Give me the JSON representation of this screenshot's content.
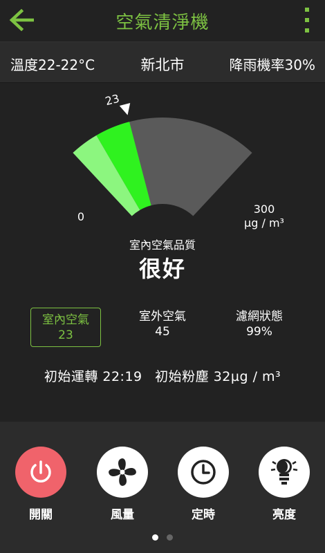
{
  "header": {
    "title": "空氣清淨機",
    "back_icon": "arrow-left-icon",
    "menu_icon": "more-vertical-icon",
    "accent_color": "#7dc242"
  },
  "weather": {
    "temperature": "溫度22-22°C",
    "city": "新北市",
    "rain_chance": "降雨機率30%"
  },
  "gauge": {
    "value": 23,
    "value_label": "23",
    "min_label": "0",
    "max_label": "300",
    "unit_label": "µg / m³",
    "min": 0,
    "max": 300
  },
  "air_quality": {
    "label": "室內空氣品質",
    "status": "很好"
  },
  "stats": {
    "indoor": {
      "label": "室內空氣",
      "value": "23"
    },
    "outdoor": {
      "label": "室外空氣",
      "value": "45"
    },
    "filter": {
      "label": "濾網狀態",
      "value": "99%"
    }
  },
  "run_info": {
    "start_time": "初始運轉 22:19",
    "initial_dust": "初始粉塵 32µg / m³"
  },
  "controls": [
    {
      "label": "開關",
      "icon": "power-icon"
    },
    {
      "label": "風量",
      "icon": "fan-icon"
    },
    {
      "label": "定時",
      "icon": "clock-icon"
    },
    {
      "label": "亮度",
      "icon": "bulb-icon"
    }
  ],
  "pager": {
    "current": 1,
    "total": 2
  },
  "colors": {
    "background": "#222222",
    "panel": "#2c2c2c",
    "gauge_light_green": "#8cf67f",
    "gauge_bright_green": "#2ff21f",
    "gauge_gray": "#5a5a5a",
    "power_red": "#f0636b"
  }
}
